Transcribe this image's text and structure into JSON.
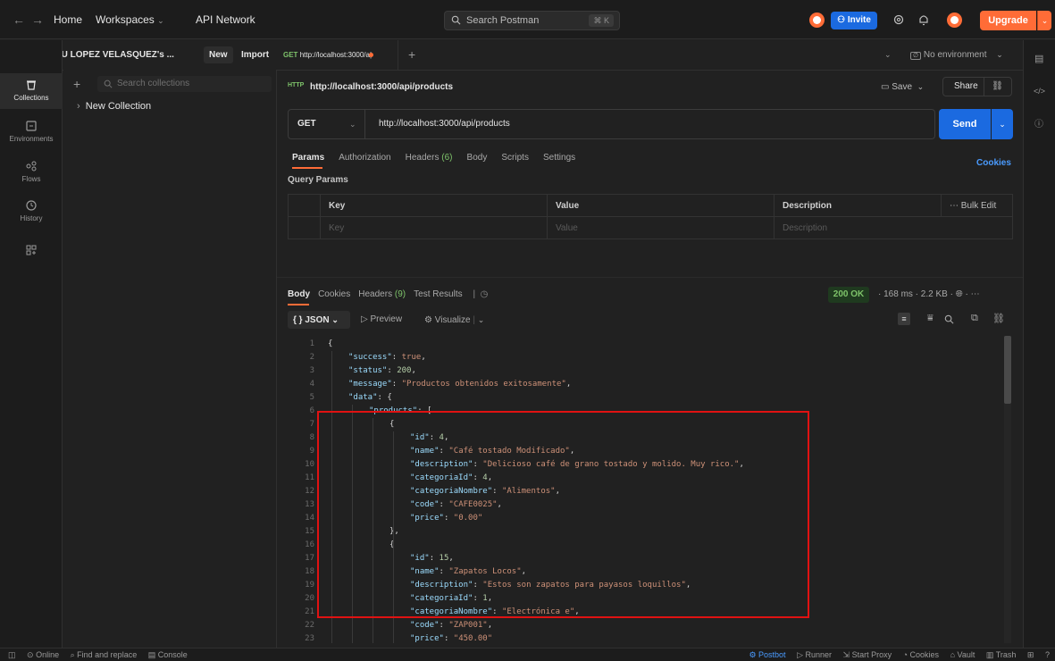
{
  "topbar": {
    "nav_home": "Home",
    "nav_workspaces": "Workspaces",
    "nav_api_network": "API Network",
    "search_placeholder": "Search Postman",
    "search_shortcut": "⌘ K",
    "invite_label": "Invite",
    "upgrade_label": "Upgrade",
    "brand_color": "#ff6c37",
    "accent_color": "#1b6ae0"
  },
  "sidebar": {
    "workspace_name": "JOB ELIU LOPEZ VELASQUEZ's ...",
    "new_label": "New",
    "import_label": "Import",
    "search_placeholder": "Search collections",
    "collections": [
      "New Collection"
    ]
  },
  "rail": {
    "items": [
      {
        "label": "Collections",
        "icon": "trash-can-icon"
      },
      {
        "label": "Environments",
        "icon": "environment-icon"
      },
      {
        "label": "Flows",
        "icon": "flows-icon"
      },
      {
        "label": "History",
        "icon": "history-icon"
      },
      {
        "label": "",
        "icon": "add-workbench-icon"
      }
    ]
  },
  "tabs": {
    "active_method": "GET",
    "active_label": "http://localhost:3000/a|",
    "environment": "No environment"
  },
  "request": {
    "title": "http://localhost:3000/api/products",
    "http_badge": "HTTP",
    "save_label": "Save",
    "share_label": "Share",
    "method": "GET",
    "url": "http://localhost:3000/api/products",
    "send_label": "Send",
    "tabs": [
      "Params",
      "Authorization",
      "Headers",
      "Body",
      "Scripts",
      "Settings"
    ],
    "headers_count": "(6)",
    "cookies_label": "Cookies",
    "query_params_label": "Query Params",
    "table_headers": [
      "Key",
      "Value",
      "Description"
    ],
    "bulk_edit_label": "Bulk Edit",
    "row_placeholders": [
      "Key",
      "Value",
      "Description"
    ]
  },
  "response": {
    "tabs": [
      "Body",
      "Cookies",
      "Headers",
      "Test Results"
    ],
    "headers_count": "(9)",
    "status": "200 OK",
    "time": "168 ms",
    "size": "2.2 KB",
    "format": "JSON",
    "preview_label": "Preview",
    "visualize_label": "Visualize",
    "code_lines": [
      {
        "n": "1",
        "indent": 0,
        "segs": [
          [
            "p",
            "{"
          ]
        ]
      },
      {
        "n": "2",
        "indent": 1,
        "segs": [
          [
            "k",
            "\"success\""
          ],
          [
            "p",
            ": "
          ],
          [
            "b",
            "true"
          ],
          [
            "p",
            ","
          ]
        ]
      },
      {
        "n": "3",
        "indent": 1,
        "segs": [
          [
            "k",
            "\"status\""
          ],
          [
            "p",
            ": "
          ],
          [
            "n",
            "200"
          ],
          [
            "p",
            ","
          ]
        ]
      },
      {
        "n": "4",
        "indent": 1,
        "segs": [
          [
            "k",
            "\"message\""
          ],
          [
            "p",
            ": "
          ],
          [
            "s",
            "\"Productos obtenidos exitosamente\""
          ],
          [
            "p",
            ","
          ]
        ]
      },
      {
        "n": "5",
        "indent": 1,
        "segs": [
          [
            "k",
            "\"data\""
          ],
          [
            "p",
            ": {"
          ]
        ]
      },
      {
        "n": "6",
        "indent": 2,
        "segs": [
          [
            "k",
            "\"products\""
          ],
          [
            "p",
            ": ["
          ]
        ]
      },
      {
        "n": "7",
        "indent": 3,
        "segs": [
          [
            "p",
            "{"
          ]
        ]
      },
      {
        "n": "8",
        "indent": 4,
        "segs": [
          [
            "k",
            "\"id\""
          ],
          [
            "p",
            ": "
          ],
          [
            "n",
            "4"
          ],
          [
            "p",
            ","
          ]
        ]
      },
      {
        "n": "9",
        "indent": 4,
        "segs": [
          [
            "k",
            "\"name\""
          ],
          [
            "p",
            ": "
          ],
          [
            "s",
            "\"Café tostado Modificado\""
          ],
          [
            "p",
            ","
          ]
        ]
      },
      {
        "n": "10",
        "indent": 4,
        "segs": [
          [
            "k",
            "\"description\""
          ],
          [
            "p",
            ": "
          ],
          [
            "s",
            "\"Delicioso café de grano tostado y molido. Muy rico.\""
          ],
          [
            "p",
            ","
          ]
        ]
      },
      {
        "n": "11",
        "indent": 4,
        "segs": [
          [
            "k",
            "\"categoriaId\""
          ],
          [
            "p",
            ": "
          ],
          [
            "n",
            "4"
          ],
          [
            "p",
            ","
          ]
        ]
      },
      {
        "n": "12",
        "indent": 4,
        "segs": [
          [
            "k",
            "\"categoriaNombre\""
          ],
          [
            "p",
            ": "
          ],
          [
            "s",
            "\"Alimentos\""
          ],
          [
            "p",
            ","
          ]
        ]
      },
      {
        "n": "13",
        "indent": 4,
        "segs": [
          [
            "k",
            "\"code\""
          ],
          [
            "p",
            ": "
          ],
          [
            "s",
            "\"CAFE0025\""
          ],
          [
            "p",
            ","
          ]
        ]
      },
      {
        "n": "14",
        "indent": 4,
        "segs": [
          [
            "k",
            "\"price\""
          ],
          [
            "p",
            ": "
          ],
          [
            "s",
            "\"0.00\""
          ]
        ]
      },
      {
        "n": "15",
        "indent": 3,
        "segs": [
          [
            "p",
            "},"
          ]
        ]
      },
      {
        "n": "16",
        "indent": 3,
        "segs": [
          [
            "p",
            "{"
          ]
        ]
      },
      {
        "n": "17",
        "indent": 4,
        "segs": [
          [
            "k",
            "\"id\""
          ],
          [
            "p",
            ": "
          ],
          [
            "n",
            "15"
          ],
          [
            "p",
            ","
          ]
        ]
      },
      {
        "n": "18",
        "indent": 4,
        "segs": [
          [
            "k",
            "\"name\""
          ],
          [
            "p",
            ": "
          ],
          [
            "s",
            "\"Zapatos Locos\""
          ],
          [
            "p",
            ","
          ]
        ]
      },
      {
        "n": "19",
        "indent": 4,
        "segs": [
          [
            "k",
            "\"description\""
          ],
          [
            "p",
            ": "
          ],
          [
            "s",
            "\"Estos son zapatos para payasos loquillos\""
          ],
          [
            "p",
            ","
          ]
        ]
      },
      {
        "n": "20",
        "indent": 4,
        "segs": [
          [
            "k",
            "\"categoriaId\""
          ],
          [
            "p",
            ": "
          ],
          [
            "n",
            "1"
          ],
          [
            "p",
            ","
          ]
        ]
      },
      {
        "n": "21",
        "indent": 4,
        "segs": [
          [
            "k",
            "\"categoriaNombre\""
          ],
          [
            "p",
            ": "
          ],
          [
            "s",
            "\"Electrónica e\""
          ],
          [
            "p",
            ","
          ]
        ]
      },
      {
        "n": "22",
        "indent": 4,
        "segs": [
          [
            "k",
            "\"code\""
          ],
          [
            "p",
            ": "
          ],
          [
            "s",
            "\"ZAP001\""
          ],
          [
            "p",
            ","
          ]
        ]
      },
      {
        "n": "23",
        "indent": 4,
        "segs": [
          [
            "k",
            "\"price\""
          ],
          [
            "p",
            ": "
          ],
          [
            "s",
            "\"450.00\""
          ]
        ]
      },
      {
        "n": "24",
        "indent": 3,
        "segs": [
          [
            "p",
            "},"
          ]
        ]
      }
    ]
  },
  "statusbar": {
    "online": "Online",
    "find_replace": "Find and replace",
    "console": "Console",
    "postbot": "Postbot",
    "runner": "Runner",
    "start_proxy": "Start Proxy",
    "cookies": "Cookies",
    "vault": "Vault",
    "trash": "Trash"
  }
}
